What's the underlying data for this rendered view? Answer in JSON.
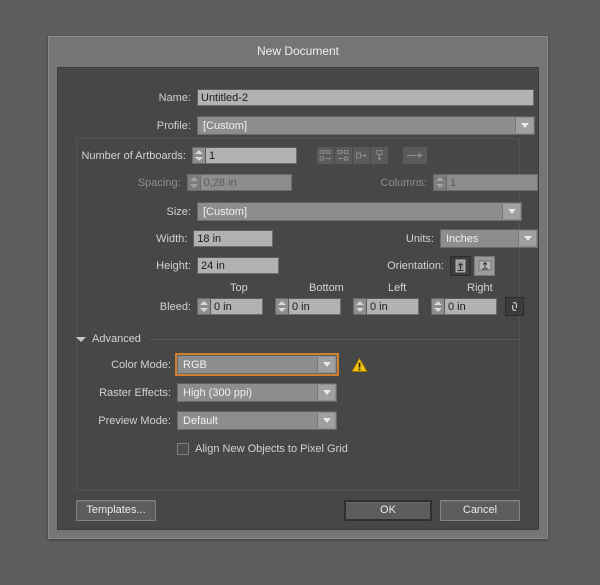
{
  "dialog": {
    "title": "New Document"
  },
  "name_row": {
    "label": "Name:",
    "value": "Untitled-2"
  },
  "profile_row": {
    "label": "Profile:",
    "value": "[Custom]"
  },
  "artboards_row": {
    "label": "Number of Artboards:",
    "value": "1",
    "arrange_buttons": [
      "grid-by-row-icon",
      "grid-by-column-icon",
      "arrange-left-to-right-icon",
      "arrange-top-to-bottom-icon"
    ],
    "flow_button": "change-to-right-to-left-icon"
  },
  "spacing_row": {
    "label": "Spacing:",
    "value": "0,28 in",
    "disabled": true
  },
  "columns_row": {
    "label": "Columns:",
    "value": "1",
    "disabled": true
  },
  "size_row": {
    "label": "Size:",
    "value": "[Custom]"
  },
  "width_row": {
    "label": "Width:",
    "value": "18 in"
  },
  "height_row": {
    "label": "Height:",
    "value": "24 in"
  },
  "units_row": {
    "label": "Units:",
    "value": "Inches"
  },
  "orientation_row": {
    "label": "Orientation:",
    "portrait_icon": "orientation-portrait-icon",
    "landscape_icon": "orientation-landscape-icon"
  },
  "bleed": {
    "label": "Bleed:",
    "top_label": "Top",
    "bottom_label": "Bottom",
    "left_label": "Left",
    "right_label": "Right",
    "top_value": "0 in",
    "bottom_value": "0 in",
    "left_value": "0 in",
    "right_value": "0 in",
    "link_icon": "link-chain-icon"
  },
  "advanced": {
    "label": "Advanced",
    "color_mode": {
      "label": "Color Mode:",
      "value": "RGB",
      "focused": true,
      "warning_icon": "warning-triangle-icon"
    },
    "raster_effects": {
      "label": "Raster Effects:",
      "value": "High (300 ppi)"
    },
    "preview_mode": {
      "label": "Preview Mode:",
      "value": "Default"
    },
    "align_pixel_grid": {
      "label": "Align New Objects to Pixel Grid",
      "checked": false
    }
  },
  "footer": {
    "templates_label": "Templates...",
    "ok_label": "OK",
    "cancel_label": "Cancel"
  },
  "colors": {
    "page_background": "#5e5e5e",
    "dialog_frame": "#757575",
    "dialog_body": "#474747",
    "field_background": "#b2b2b2",
    "dropdown_background": "#8d8d8d",
    "focus_orange": "#cf7f2e",
    "warning_yellow": "#f2c317",
    "label_text": "#d2d2d2"
  }
}
